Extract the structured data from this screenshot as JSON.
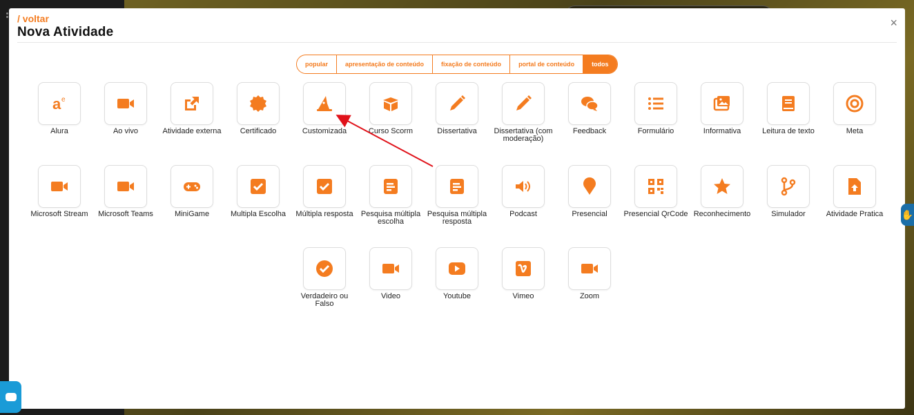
{
  "header": {
    "back_label": "/ voltar",
    "title": "Nova Atividade",
    "close_glyph": "×"
  },
  "filters": [
    {
      "label": "popular",
      "active": false
    },
    {
      "label": "apresentação de conteúdo",
      "active": false
    },
    {
      "label": "fixação de conteúdo",
      "active": false
    },
    {
      "label": "portal de conteúdo",
      "active": false
    },
    {
      "label": "todos",
      "active": true
    }
  ],
  "accent_color": "#f47c20",
  "activities": [
    {
      "label": "Alura",
      "icon": "alura-icon"
    },
    {
      "label": "Ao vivo",
      "icon": "video-camera-icon"
    },
    {
      "label": "Atividade externa",
      "icon": "external-link-icon"
    },
    {
      "label": "Certificado",
      "icon": "certificate-icon"
    },
    {
      "label": "Customizada",
      "icon": "wizard-hat-icon"
    },
    {
      "label": "Curso Scorm",
      "icon": "box-icon"
    },
    {
      "label": "Dissertativa",
      "icon": "pencil-icon"
    },
    {
      "label": "Dissertativa (com moderação)",
      "icon": "pencil-icon"
    },
    {
      "label": "Feedback",
      "icon": "chat-bubbles-icon"
    },
    {
      "label": "Formulário",
      "icon": "list-icon"
    },
    {
      "label": "Informativa",
      "icon": "images-icon"
    },
    {
      "label": "Leitura de texto",
      "icon": "book-icon"
    },
    {
      "label": "Meta",
      "icon": "target-icon"
    },
    {
      "label": "Microsoft Stream",
      "icon": "video-camera-icon"
    },
    {
      "label": "Microsoft Teams",
      "icon": "video-camera-icon"
    },
    {
      "label": "MiniGame",
      "icon": "gamepad-icon"
    },
    {
      "label": "Multipla Escolha",
      "icon": "checkbox-icon"
    },
    {
      "label": "Múltipla resposta",
      "icon": "checkbox-icon"
    },
    {
      "label": "Pesquisa múltipla escolha",
      "icon": "document-icon"
    },
    {
      "label": "Pesquisa múltipla resposta",
      "icon": "document-icon"
    },
    {
      "label": "Podcast",
      "icon": "speaker-icon"
    },
    {
      "label": "Presencial",
      "icon": "map-pin-icon"
    },
    {
      "label": "Presencial QrCode",
      "icon": "qrcode-icon"
    },
    {
      "label": "Reconhecimento",
      "icon": "star-icon"
    },
    {
      "label": "Simulador",
      "icon": "code-branch-icon"
    },
    {
      "label": "Atividade Pratica",
      "icon": "file-upload-icon"
    },
    {
      "label": "Verdadeiro ou Falso",
      "icon": "check-circle-icon"
    },
    {
      "label": "Video",
      "icon": "video-camera-icon"
    },
    {
      "label": "Youtube",
      "icon": "youtube-icon"
    },
    {
      "label": "Vimeo",
      "icon": "vimeo-icon"
    },
    {
      "label": "Zoom",
      "icon": "video-camera-icon"
    }
  ]
}
